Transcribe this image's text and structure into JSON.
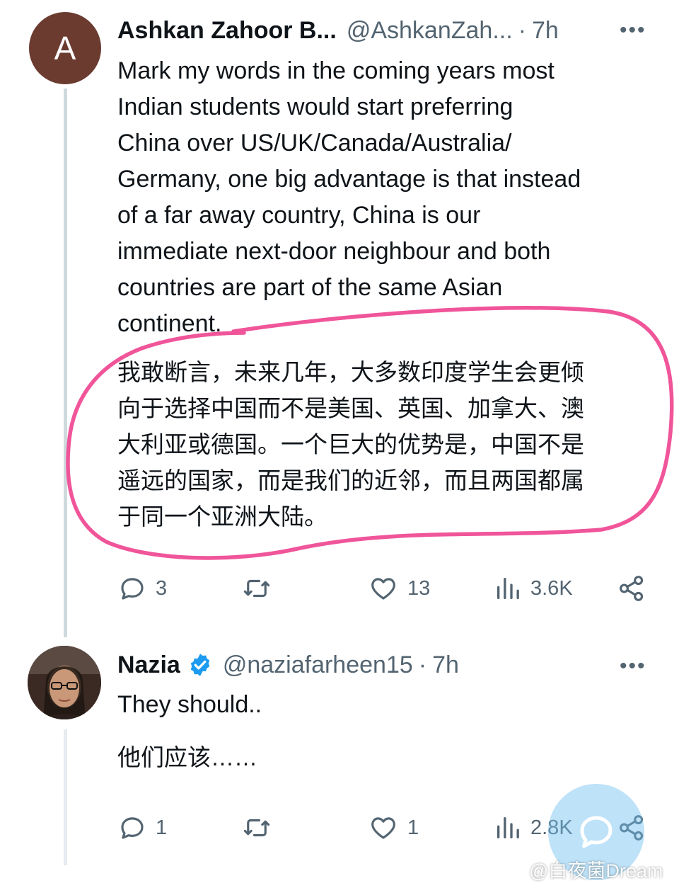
{
  "tweet1": {
    "avatar_letter": "A",
    "name": "Ashkan Zahoor B...",
    "handle": "@AshkanZah...",
    "separator": "·",
    "time": "7h",
    "more": "•••",
    "text_lines": [
      "Mark my words in the coming years most",
      "Indian students would start preferring",
      "China over US/UK/Canada/Australia/",
      "Germany, one big advantage is that instead",
      "of a far away country, China is our",
      "immediate next-door neighbour and both",
      "countries are part of the same Asian",
      "continent."
    ],
    "translation_lines": [
      "我敢断言，未来几年，大多数印度学生会更倾",
      "向于选择中国而不是美国、英国、加拿大、澳",
      "大利亚或德国。一个巨大的优势是，中国不是",
      "遥远的国家，而是我们的近邻，而且两国都属",
      "于同一个亚洲大陆。"
    ],
    "replies": "3",
    "retweets": "",
    "likes": "13",
    "views": "3.6K"
  },
  "tweet2": {
    "name": "Nazia",
    "handle": "@naziafarheen15",
    "separator": "·",
    "time": "7h",
    "more": "•••",
    "text": "They should..",
    "translation": "他们应该……",
    "replies": "1",
    "retweets": "",
    "likes": "1",
    "views": "2.8K"
  },
  "watermark": "@白夜菌Dream",
  "colors": {
    "accent": "#1d9bf0",
    "annotation": "#f0559a",
    "muted": "#536471",
    "avatar_bg": "#6b3b30"
  }
}
